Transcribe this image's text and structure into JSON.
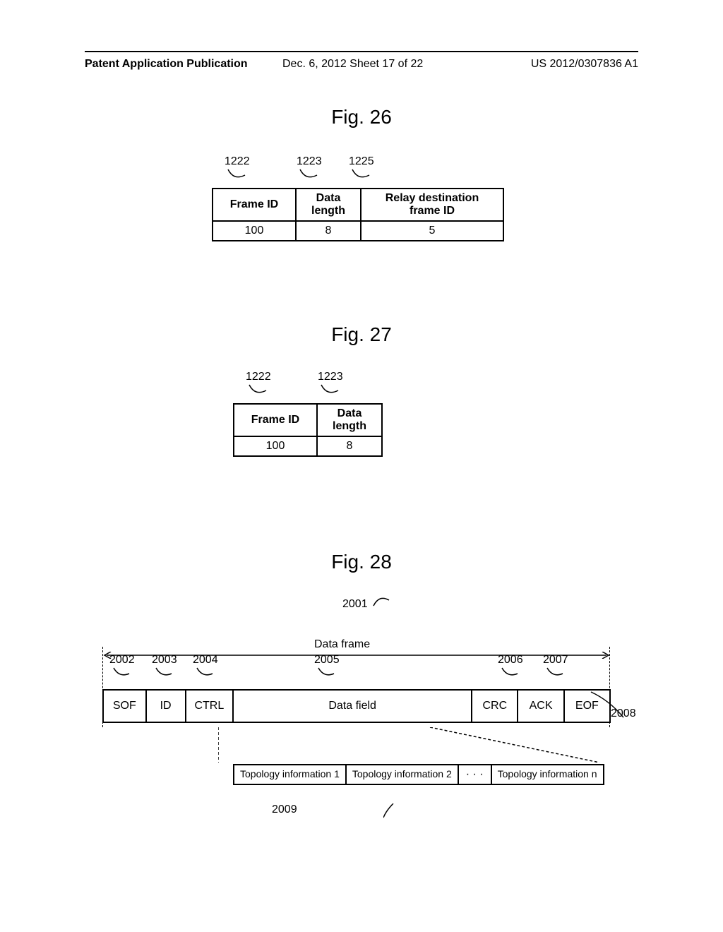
{
  "header": {
    "left": "Patent Application Publication",
    "center": "Dec. 6, 2012   Sheet 17 of 22",
    "right": "US 2012/0307836 A1"
  },
  "fig26": {
    "title": "Fig. 26",
    "callouts": {
      "c1": "1222",
      "c2": "1223",
      "c3": "1225"
    },
    "th1": "Frame ID",
    "th2": "Data length",
    "th3": "Relay destination frame ID",
    "td1": "100",
    "td2": "8",
    "td3": "5"
  },
  "fig27": {
    "title": "Fig. 27",
    "callouts": {
      "c1": "1222",
      "c2": "1223"
    },
    "th1": "Frame ID",
    "th2": "Data length",
    "td1": "100",
    "td2": "8"
  },
  "fig28": {
    "title": "Fig. 28",
    "dataframe_callout": "2001",
    "dataframe_label": "Data frame",
    "field_callouts": {
      "sof": "2002",
      "id": "2003",
      "ctrl": "2004",
      "data": "2005",
      "crc": "2006",
      "ack": "2007",
      "eof": "2008"
    },
    "fields": {
      "sof": "SOF",
      "id": "ID",
      "ctrl": "CTRL",
      "data": "Data field",
      "crc": "CRC",
      "ack": "ACK",
      "eof": "EOF"
    },
    "topo": {
      "t1": "Topology information 1",
      "t2": "Topology information 2",
      "dots": "· · ·",
      "tn": "Topology information n",
      "callout": "2009"
    }
  }
}
